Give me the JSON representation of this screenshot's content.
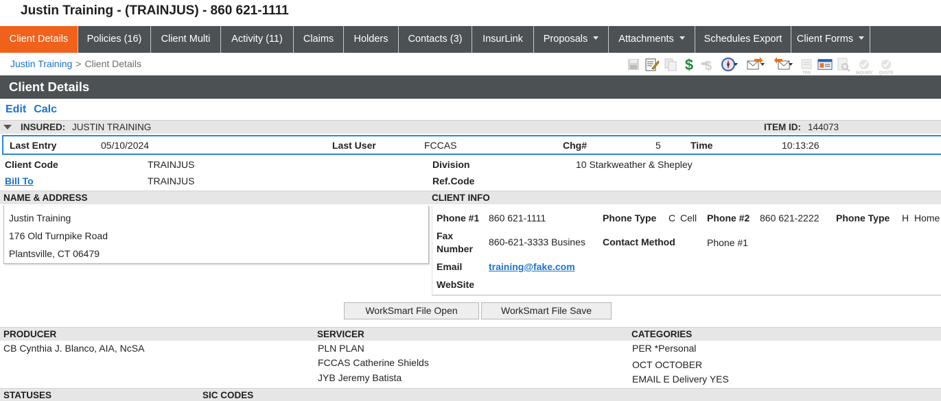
{
  "page": {
    "title": "Justin Training - (TRAINJUS) - 860 621-1111"
  },
  "tabs": [
    {
      "label": "Client Details",
      "active": true,
      "dropdown": false
    },
    {
      "label": "Policies (16)",
      "dropdown": false
    },
    {
      "label": "Client Multi",
      "dropdown": false
    },
    {
      "label": "Activity (11)",
      "dropdown": false
    },
    {
      "label": "Claims",
      "dropdown": false
    },
    {
      "label": "Holders",
      "dropdown": false
    },
    {
      "label": "Contacts (3)",
      "dropdown": false
    },
    {
      "label": "InsurLink",
      "dropdown": false
    },
    {
      "label": "Proposals",
      "dropdown": true
    },
    {
      "label": "Attachments",
      "dropdown": true
    },
    {
      "label": "Schedules Export",
      "dropdown": false
    },
    {
      "label": "Client Forms",
      "dropdown": true
    }
  ],
  "breadcrumb": {
    "parent": "Justin Training",
    "separator": ">",
    "current": "Client Details"
  },
  "toolbar": {
    "icons": [
      {
        "name": "save-icon",
        "enabled": false
      },
      {
        "name": "edit-notes-icon",
        "enabled": true
      },
      {
        "name": "copy-icon",
        "enabled": false
      },
      {
        "name": "dollar-icon",
        "enabled": true
      },
      {
        "name": "exchange-icon",
        "enabled": false
      },
      {
        "name": "compass-icon",
        "enabled": true,
        "dropdown": true
      },
      {
        "name": "mail-out-icon",
        "enabled": true,
        "dropdown": true
      },
      {
        "name": "mail-in-icon",
        "enabled": true,
        "dropdown": true
      },
      {
        "name": "trn-icon",
        "enabled": false,
        "label": "TRN"
      },
      {
        "name": "id-card-icon",
        "enabled": true
      },
      {
        "name": "search-doc-icon",
        "enabled": false
      },
      {
        "name": "inquiry-icon",
        "enabled": false,
        "label": "INQUIRY"
      },
      {
        "name": "quote-icon",
        "enabled": false,
        "label": "QUOTE"
      }
    ],
    "accent_colors": {
      "dollar": "#1f8a3c",
      "orange": "#e8731a",
      "blue": "#2b5fa8"
    }
  },
  "section": {
    "title": "Client Details"
  },
  "actions": {
    "edit": "Edit",
    "calc": "Calc"
  },
  "insured": {
    "label": "INSURED:",
    "value": "JUSTIN TRAINING",
    "item_id_label": "ITEM ID:",
    "item_id": "144073"
  },
  "entry": {
    "last_entry_label": "Last Entry",
    "last_entry": "05/10/2024",
    "last_user_label": "Last User",
    "last_user": "FCCAS",
    "chg_label": "Chg#",
    "chg": "5",
    "time_label": "Time",
    "time": "10:13:26"
  },
  "client": {
    "code_label": "Client Code",
    "code": "TRAINJUS",
    "bill_to_label": "Bill To",
    "bill_to": "TRAINJUS",
    "division_label": "Division",
    "division": "10 Starkweather & Shepley",
    "ref_code_label": "Ref.Code",
    "ref_code": ""
  },
  "name_address": {
    "header": "NAME & ADDRESS",
    "lines": [
      "Justin Training",
      "176 Old Turnpike Road",
      "Plantsville, CT  06479"
    ]
  },
  "client_info": {
    "header": "CLIENT INFO",
    "phone1_label": "Phone #1",
    "phone1": "860 621-1111",
    "phone_type_label": "Phone Type",
    "phone_type_code": "C",
    "phone_type": "Cell",
    "phone2_label": "Phone #2",
    "phone2": "860 621-2222",
    "phone_type2_label": "Phone Type",
    "phone_type2_code": "H",
    "phone_type2": "Home",
    "fax_label_1": "Fax",
    "fax_label_2": "Number",
    "fax": "860-621-3333 Busines",
    "contact_method_label": "Contact Method",
    "contact_method": "Phone #1",
    "email_label": "Email",
    "email": "training@fake.com",
    "website_label": "WebSite",
    "website": ""
  },
  "buttons": {
    "open": "WorkSmart File Open",
    "save": "WorkSmart File Save"
  },
  "producer": {
    "header": "PRODUCER",
    "items": [
      "CB Cynthia J. Blanco, AIA, NcSA"
    ]
  },
  "servicer": {
    "header": "SERVICER",
    "items": [
      "PLN PLAN",
      "FCCAS Catherine Shields",
      "JYB Jeremy Batista"
    ]
  },
  "categories": {
    "header": "CATEGORIES",
    "items": [
      "PER *Personal",
      "OCT OCTOBER",
      "EMAIL E Delivery YES"
    ]
  },
  "statuses": {
    "header": "STATUSES"
  },
  "sic_codes": {
    "header": "SIC CODES"
  }
}
